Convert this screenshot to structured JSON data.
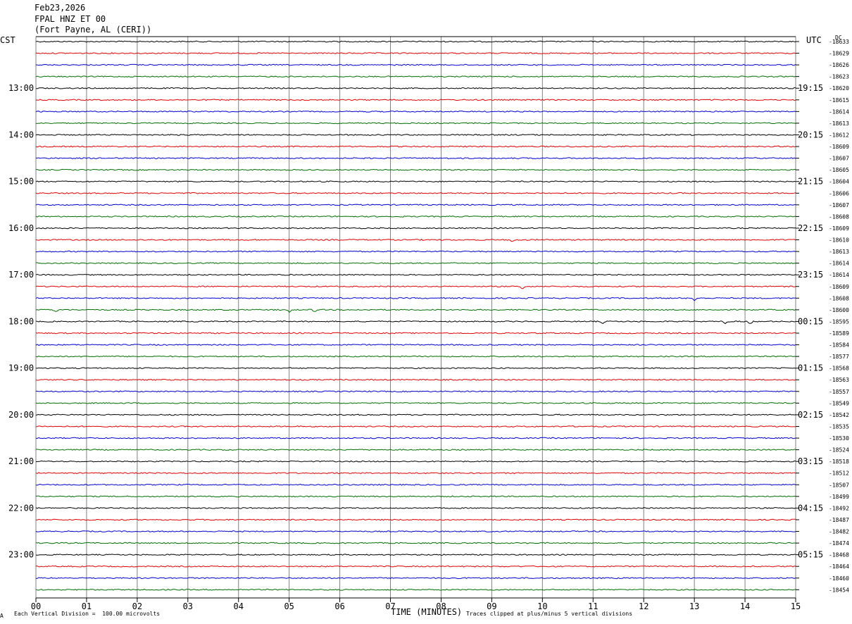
{
  "header": {
    "date": "Feb23,2026",
    "station": "FPAL HNZ ET 00",
    "location": "(Fort Payne, AL (CERI))",
    "left_tz": "CST",
    "right_tz": "UTC",
    "dc_label": "DC"
  },
  "footer": {
    "scale_note": "Each Vertical Division =  100.00 microvolts",
    "xlabel": "TIME (MINUTES)",
    "clip_note": "Traces clipped at plus/minus 5 vertical divisions",
    "corner_mark": "A"
  },
  "colors": {
    "trace_cycle": [
      "#000000",
      "#e00000",
      "#0000d0",
      "#007000"
    ],
    "grid": "#808080",
    "background": "#ffffff"
  },
  "chart_data": {
    "type": "line",
    "subtype": "helicorder",
    "xlabel": "TIME (MINUTES)",
    "xlim": [
      0,
      15
    ],
    "x_ticks": [
      "00",
      "01",
      "02",
      "03",
      "04",
      "05",
      "06",
      "07",
      "08",
      "09",
      "10",
      "11",
      "12",
      "13",
      "14",
      "15"
    ],
    "left_hour_labels": [
      "13:00",
      "14:00",
      "15:00",
      "16:00",
      "17:00",
      "18:00",
      "19:00",
      "20:00",
      "21:00",
      "22:00",
      "23:00"
    ],
    "right_hour_labels": [
      "19:15",
      "20:15",
      "21:15",
      "22:15",
      "23:15",
      "00:15",
      "01:15",
      "02:15",
      "03:15",
      "04:15",
      "05:15"
    ],
    "first_labeled_trace": 4,
    "traces_per_hour": 4,
    "trace_count": 48,
    "dc_offsets": [
      "-18633",
      "-18629",
      "-18626",
      "-18623",
      "-18620",
      "-18615",
      "-18614",
      "-18613",
      "-18612",
      "-18609",
      "-18607",
      "-18605",
      "-18604",
      "-18606",
      "-18607",
      "-18608",
      "-18609",
      "-18610",
      "-18613",
      "-18614",
      "-18614",
      "-18609",
      "-18608",
      "-18600",
      "-18595",
      "-18589",
      "-18584",
      "-18577",
      "-18568",
      "-18563",
      "-18557",
      "-18549",
      "-18542",
      "-18535",
      "-18530",
      "-18524",
      "-18518",
      "-18512",
      "-18507",
      "-18499",
      "-18492",
      "-18487",
      "-18482",
      "-18474",
      "-18468",
      "-18464",
      "-18460",
      "-18454"
    ],
    "events": [
      {
        "trace": 22,
        "minute": 13.0,
        "note": "small blue excursion"
      },
      {
        "trace": 23,
        "minute": 0.4,
        "note": "green dips"
      },
      {
        "trace": 23,
        "minute": 5.0,
        "note": "green dips"
      },
      {
        "trace": 23,
        "minute": 5.5,
        "note": "green dips"
      },
      {
        "trace": 24,
        "minute": 11.2,
        "note": "black step"
      },
      {
        "trace": 24,
        "minute": 13.6,
        "note": "black dips"
      },
      {
        "trace": 24,
        "minute": 14.1,
        "note": "black dips"
      },
      {
        "trace": 17,
        "minute": 9.4,
        "note": "red dip"
      },
      {
        "trace": 21,
        "minute": 9.6,
        "note": "red dip"
      }
    ]
  }
}
